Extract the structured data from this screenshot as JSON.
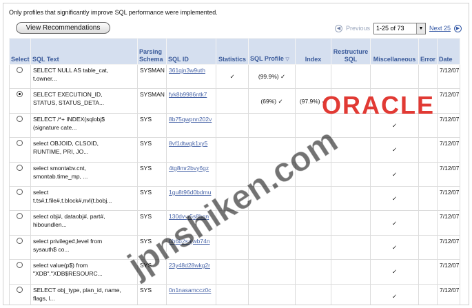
{
  "notice": "Only profiles that significantly improve SQL performance were implemented.",
  "toolbar": {
    "view_recommendations": "View Recommendations"
  },
  "pager": {
    "previous": "Previous",
    "range": "1-25 of 73",
    "next": "Next 25"
  },
  "columns": {
    "select": "Select",
    "sql_text": "SQL Text",
    "parsing_schema_1": "Parsing",
    "parsing_schema_2": "Schema",
    "sql_id": "SQL ID",
    "statistics": "Statistics",
    "sql_profile": "SQL Profile",
    "index": "Index",
    "restructure_1": "Restructure",
    "restructure_2": "SQL",
    "misc": "Miscellaneous",
    "error": "Error",
    "date": "Date"
  },
  "rows": [
    {
      "selected": false,
      "text1": "SELECT NULL AS table_cat,",
      "text2": "t.owner...",
      "schema": "SYSMAN",
      "sql_id": "361qjn3w9uth",
      "statistics": "✓",
      "profile": "(99.9%) ✓",
      "index": "",
      "misc": "",
      "date": "7/12/07"
    },
    {
      "selected": true,
      "text1": "SELECT EXECUTION_ID,",
      "text2": "STATUS, STATUS_DETA...",
      "schema": "SYSMAN",
      "sql_id": "fyk8b9986ntk7",
      "statistics": "",
      "profile": "(69%) ✓",
      "index": "(97.9%) ✓",
      "misc": "",
      "date": "7/12/07"
    },
    {
      "selected": false,
      "text1": "SELECT /*+ INDEX(sqlobj$",
      "text2": "(signature cate...",
      "schema": "SYS",
      "sql_id": "8b75qwpnn202v",
      "statistics": "",
      "profile": "",
      "index": "",
      "misc": "✓",
      "date": "7/12/07"
    },
    {
      "selected": false,
      "text1": "select OBJOID, CLSOID,",
      "text2": "RUNTIME, PRI, JO...",
      "schema": "SYS",
      "sql_id": "8vf1dtwgk1xy5",
      "statistics": "",
      "profile": "",
      "index": "",
      "misc": "✓",
      "date": "7/12/07"
    },
    {
      "selected": false,
      "text1": "select smontabv.cnt,",
      "text2": "smontab.time_mp, ...",
      "schema": "SYS",
      "sql_id": "4tg8mr2bvy6gz",
      "statistics": "",
      "profile": "",
      "index": "",
      "misc": "✓",
      "date": "7/12/07"
    },
    {
      "selected": false,
      "text1": "select",
      "text2": "t.ts#,t.file#,t.block#,nvl(t.bobj...",
      "schema": "SYS",
      "sql_id": "1gu8t96d0bdmu",
      "statistics": "",
      "profile": "",
      "index": "",
      "misc": "✓",
      "date": "7/12/07"
    },
    {
      "selected": false,
      "text1": "select obj#, dataobj#, part#,",
      "text2": "hiboundlen...",
      "schema": "SYS",
      "sql_id": "130dvvr5s8bgn",
      "statistics": "",
      "profile": "",
      "index": "",
      "misc": "✓",
      "date": "7/12/07"
    },
    {
      "selected": false,
      "text1": "select privilege#,level from",
      "text2": "sysauth$ co...",
      "schema": "SYS",
      "sql_id": "0h6b2sajwb74n",
      "statistics": "",
      "profile": "",
      "index": "",
      "misc": "✓",
      "date": "7/12/07"
    },
    {
      "selected": false,
      "text1": "select value(p$) from",
      "text2": "\"XDB\".\"XDB$RESOURC...",
      "schema": "SYS",
      "sql_id": "23y48d28wkg2r",
      "statistics": "",
      "profile": "",
      "index": "",
      "misc": "✓",
      "date": "7/12/07"
    },
    {
      "selected": false,
      "text1": "SELECT obj_type, plan_id, name,",
      "text2": "flags, l...",
      "schema": "SYS",
      "sql_id": "0n1nasamccz0c",
      "statistics": "",
      "profile": "",
      "index": "",
      "misc": "✓",
      "date": "7/12/07"
    }
  ],
  "logo": "ORACLE",
  "watermark": "jpnshiken.com"
}
